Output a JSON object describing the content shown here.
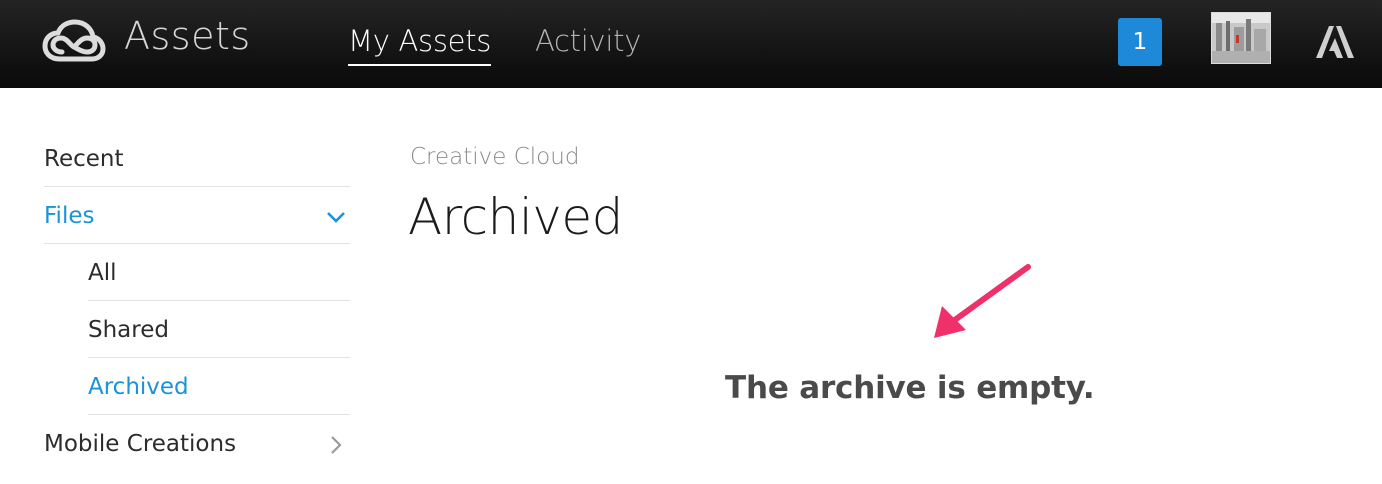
{
  "header": {
    "app_title": "Assets",
    "tabs": [
      {
        "label": "My Assets",
        "active": true
      },
      {
        "label": "Activity",
        "active": false
      }
    ],
    "notification_count": "1",
    "icons": {
      "logo": "creative-cloud-logo-icon",
      "brand": "adobe-logo-icon",
      "avatar": "user-avatar"
    }
  },
  "sidebar": {
    "items": [
      {
        "label": "Recent"
      },
      {
        "label": "Files",
        "expanded": true
      },
      {
        "label": "All"
      },
      {
        "label": "Shared"
      },
      {
        "label": "Archived",
        "selected": true
      },
      {
        "label": "Mobile Creations"
      }
    ]
  },
  "main": {
    "breadcrumb": "Creative Cloud",
    "title": "Archived",
    "empty_message": "The archive is empty."
  },
  "colors": {
    "accent": "#1a93d9",
    "badge": "#1e88d9",
    "annotation_arrow": "#f0306b",
    "header_bg": "#111111"
  }
}
